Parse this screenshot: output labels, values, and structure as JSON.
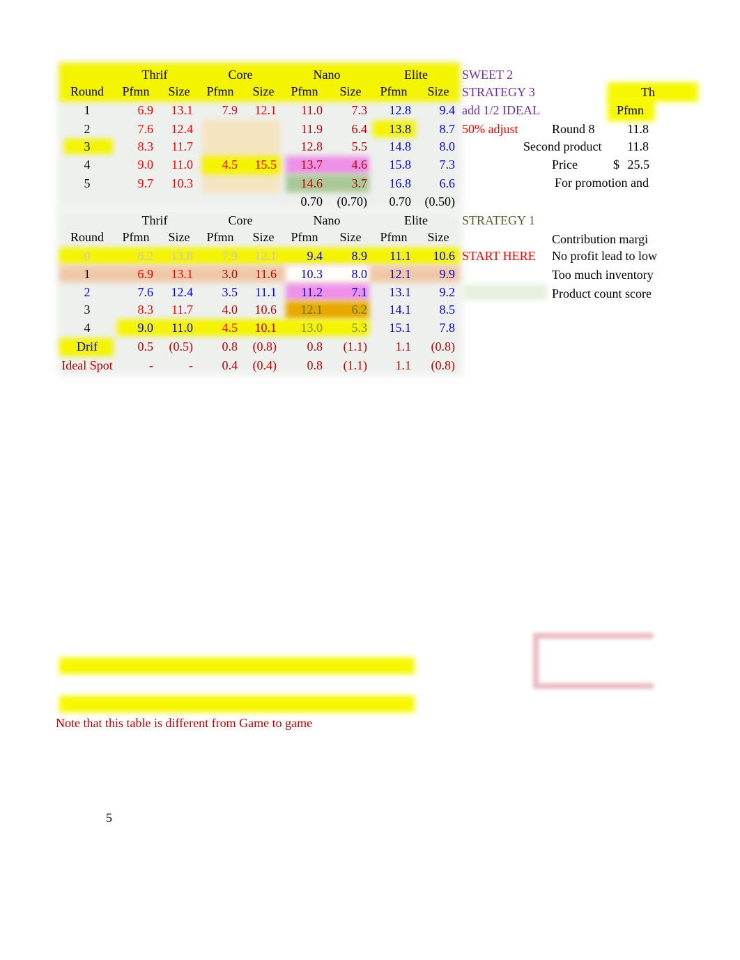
{
  "colors": {
    "highlight_yellow": "#f7f700",
    "red": "#ff0000",
    "dark_red": "#c00000",
    "blue": "#0000ee",
    "purple": "#7030a0",
    "olive": "#4f6228",
    "gray": "#c8c8c8"
  },
  "table1": {
    "groups": [
      "Thrif",
      "Core",
      "Nano",
      "Elite"
    ],
    "headers": [
      "Round",
      "Pfmn",
      "Size",
      "Pfmn",
      "Size",
      "Pfmn",
      "Size",
      "Pfmn",
      "Size"
    ],
    "rows": [
      {
        "cells": [
          "1",
          "6.9",
          "13.1",
          "7.9",
          "12.1",
          "11.0",
          "7.3",
          "12.8",
          "9.4"
        ],
        "colors": [
          "#000",
          "#ff0000",
          "#ff0000",
          "#ff0000",
          "#ff0000",
          "#c00000",
          "#c00000",
          "#0000ee",
          "#0000ee"
        ]
      },
      {
        "cells": [
          "2",
          "7.6",
          "12.4",
          "",
          "",
          "11.9",
          "6.4",
          "13.8",
          "8.7"
        ],
        "colors": [
          "#000",
          "#ff0000",
          "#ff0000",
          "#ff0000",
          "#ff0000",
          "#c00000",
          "#c00000",
          "#0000ee",
          "#0000ee"
        ]
      },
      {
        "cells": [
          "3",
          "8.3",
          "11.7",
          "",
          "",
          "12.8",
          "5.5",
          "14.8",
          "8.0"
        ],
        "colors": [
          "#000",
          "#ff0000",
          "#ff0000",
          "#ff0000",
          "#ff0000",
          "#c00000",
          "#c00000",
          "#0000ee",
          "#0000ee"
        ]
      },
      {
        "cells": [
          "4",
          "9.0",
          "11.0",
          "4.5",
          "15.5",
          "13.7",
          "4.6",
          "15.8",
          "7.3"
        ],
        "colors": [
          "#000",
          "#ff0000",
          "#ff0000",
          "#ff0000",
          "#ff0000",
          "#c00000",
          "#c00000",
          "#0000ee",
          "#0000ee"
        ]
      },
      {
        "cells": [
          "5",
          "9.7",
          "10.3",
          "",
          "",
          "14.6",
          "3.7",
          "16.8",
          "6.6"
        ],
        "colors": [
          "#000",
          "#ff0000",
          "#ff0000",
          "#ff0000",
          "#ff0000",
          "#c00000",
          "#c00000",
          "#0000ee",
          "#0000ee"
        ]
      },
      {
        "cells": [
          "",
          "",
          "",
          "",
          "",
          "0.70",
          "(0.70)",
          "0.70",
          "(0.50)"
        ],
        "colors": [
          "#000",
          "#000",
          "#000",
          "#000",
          "#000",
          "#000",
          "#000",
          "#000",
          "#000"
        ]
      }
    ]
  },
  "table2": {
    "groups": [
      "Thrif",
      "Core",
      "Nano",
      "Elite"
    ],
    "headers": [
      "Round",
      "Pfmn",
      "Size",
      "Pfmn",
      "Size",
      "Pfmn",
      "Size",
      "Pfmn",
      "Size"
    ],
    "rows": [
      {
        "cells": [
          "0",
          "6.2",
          "13.8",
          "7.9",
          "12.1",
          "9.4",
          "8.9",
          "11.1",
          "10.6"
        ],
        "colors": [
          "#c8c8c8",
          "#c8c8c8",
          "#c8c8c8",
          "#c8c8c8",
          "#c8c8c8",
          "#0000ee",
          "#0000ee",
          "#0000ee",
          "#0000ee"
        ]
      },
      {
        "cells": [
          "1",
          "6.9",
          "13.1",
          "3.0",
          "11.6",
          "10.3",
          "8.0",
          "12.1",
          "9.9"
        ],
        "colors": [
          "#000",
          "#ff0000",
          "#ff0000",
          "#c00000",
          "#c00000",
          "#0000ee",
          "#0000ee",
          "#0000ee",
          "#0000ee"
        ]
      },
      {
        "cells": [
          "2",
          "7.6",
          "12.4",
          "3.5",
          "11.1",
          "11.2",
          "7.1",
          "13.1",
          "9.2"
        ],
        "colors": [
          "#0000ee",
          "#0000ee",
          "#0000ee",
          "#0000ee",
          "#0000ee",
          "#0000ee",
          "#0000ee",
          "#0000ee",
          "#0000ee"
        ]
      },
      {
        "cells": [
          "3",
          "8.3",
          "11.7",
          "4.0",
          "10.6",
          "12.1",
          "6.2",
          "14.1",
          "8.5"
        ],
        "colors": [
          "#000",
          "#ff0000",
          "#ff0000",
          "#c00000",
          "#c00000",
          "#5a7a1a",
          "#5a7a1a",
          "#0000ee",
          "#0000ee"
        ]
      },
      {
        "cells": [
          "4",
          "9.0",
          "11.0",
          "4.5",
          "10.1",
          "13.0",
          "5.3",
          "15.1",
          "7.8"
        ],
        "colors": [
          "#000",
          "#0000ee",
          "#0000ee",
          "#ff0000",
          "#c00000",
          "#7a8a40",
          "#7a8a40",
          "#0000ee",
          "#0000ee"
        ]
      },
      {
        "cells": [
          "Drif",
          "0.5",
          "(0.5)",
          "0.8",
          "(0.8)",
          "0.8",
          "(1.1)",
          "1.1",
          "(0.8)"
        ],
        "colors": [
          "#0000ee",
          "#c00000",
          "#c00000",
          "#c00000",
          "#c00000",
          "#c00000",
          "#c00000",
          "#c00000",
          "#c00000"
        ]
      },
      {
        "cells": [
          "Ideal Spot",
          "-",
          "-",
          "0.4",
          "(0.4)",
          "0.8",
          "(1.1)",
          "1.1",
          "(0.8)"
        ],
        "colors": [
          "#c00000",
          "#c00000",
          "#c00000",
          "#c00000",
          "#c00000",
          "#c00000",
          "#c00000",
          "#c00000",
          "#c00000"
        ]
      }
    ]
  },
  "notes": {
    "sweet2": "SWEET 2",
    "strategy3": "STRATEGY 3",
    "add_half_ideal": "add 1/2 IDEAL",
    "fifty_adjust": "50% adjust",
    "th": "Th",
    "pfmn": "Pfmn",
    "round8_label": "Round 8",
    "round8_value": "11.8",
    "second_product_label": "Second product",
    "second_product_value": "11.8",
    "price_label": "Price",
    "price_currency": "$",
    "price_value": "25.5",
    "promotion": "For promotion and",
    "strategy1": "STRATEGY 1",
    "start_here": "START HERE",
    "contribution": "Contribution margi",
    "no_profit": "No profit lead to low",
    "inventory": "Too much inventory",
    "product_count": "Product count score"
  },
  "footer_note": "Note that this table is different from Game to game",
  "page_number": "5"
}
